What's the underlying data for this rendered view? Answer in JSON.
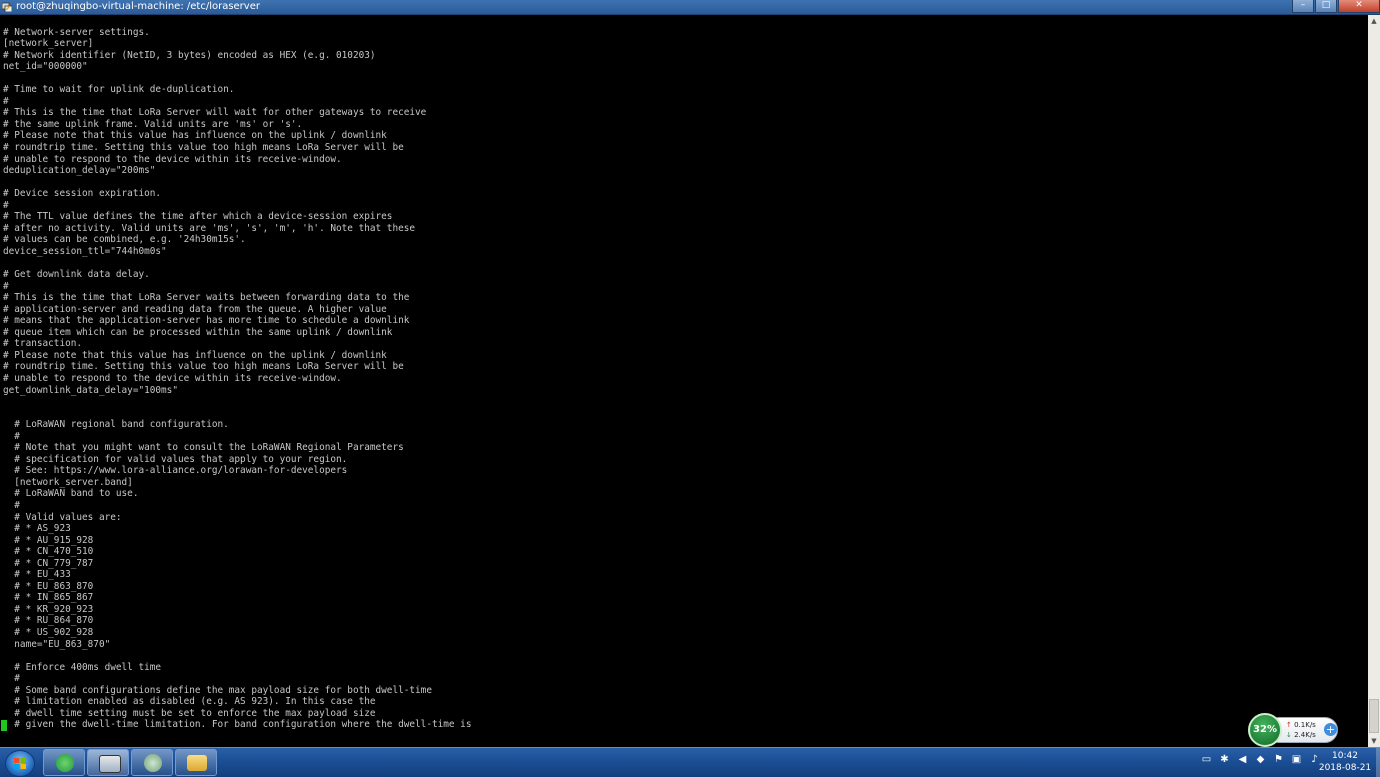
{
  "window": {
    "title": "root@zhuqingbo-virtual-machine: /etc/loraserver",
    "controls": {
      "minimize": "–",
      "maximize": "□",
      "close": "✕"
    }
  },
  "terminal": {
    "lines": [
      "",
      "# Network-server settings.",
      "[network_server]",
      "# Network identifier (NetID, 3 bytes) encoded as HEX (e.g. 010203)",
      "net_id=\"000000\"",
      "",
      "# Time to wait for uplink de-duplication.",
      "#",
      "# This is the time that LoRa Server will wait for other gateways to receive",
      "# the same uplink frame. Valid units are 'ms' or 's'.",
      "# Please note that this value has influence on the uplink / downlink",
      "# roundtrip time. Setting this value too high means LoRa Server will be",
      "# unable to respond to the device within its receive-window.",
      "deduplication_delay=\"200ms\"",
      "",
      "# Device session expiration.",
      "#",
      "# The TTL value defines the time after which a device-session expires",
      "# after no activity. Valid units are 'ms', 's', 'm', 'h'. Note that these",
      "# values can be combined, e.g. '24h30m15s'.",
      "device_session_ttl=\"744h0m0s\"",
      "",
      "# Get downlink data delay.",
      "#",
      "# This is the time that LoRa Server waits between forwarding data to the",
      "# application-server and reading data from the queue. A higher value",
      "# means that the application-server has more time to schedule a downlink",
      "# queue item which can be processed within the same uplink / downlink",
      "# transaction.",
      "# Please note that this value has influence on the uplink / downlink",
      "# roundtrip time. Setting this value too high means LoRa Server will be",
      "# unable to respond to the device within its receive-window.",
      "get_downlink_data_delay=\"100ms\"",
      "",
      "",
      "  # LoRaWAN regional band configuration.",
      "  #",
      "  # Note that you might want to consult the LoRaWAN Regional Parameters",
      "  # specification for valid values that apply to your region.",
      "  # See: https://www.lora-alliance.org/lorawan-for-developers",
      "  [network_server.band]",
      "  # LoRaWAN band to use.",
      "  #",
      "  # Valid values are:",
      "  # * AS_923",
      "  # * AU_915_928",
      "  # * CN_470_510",
      "  # * CN_779_787",
      "  # * EU_433",
      "  # * EU_863_870",
      "  # * IN_865_867",
      "  # * KR_920_923",
      "  # * RU_864_870",
      "  # * US_902_928",
      "  name=\"EU_863_870\"",
      "",
      "  # Enforce 400ms dwell time",
      "  #",
      "  # Some band configurations define the max payload size for both dwell-time",
      "  # limitation enabled as disabled (e.g. AS 923). In this case the",
      "  # dwell time setting must be set to enforce the max payload size",
      "  # given the dwell-time limitation. For band configuration where the dwell-time is"
    ]
  },
  "scrollbar": {
    "position": 0.97
  },
  "netmonitor": {
    "percent": "32%",
    "up": "0.1K/s",
    "down": "2.4K/s"
  },
  "taskbar": {
    "icons": [
      "windows-start",
      "360-browser",
      "putty",
      "chrome-like",
      "file-explorer"
    ],
    "clock": {
      "time": "10:42",
      "date": "2018-08-21"
    }
  }
}
